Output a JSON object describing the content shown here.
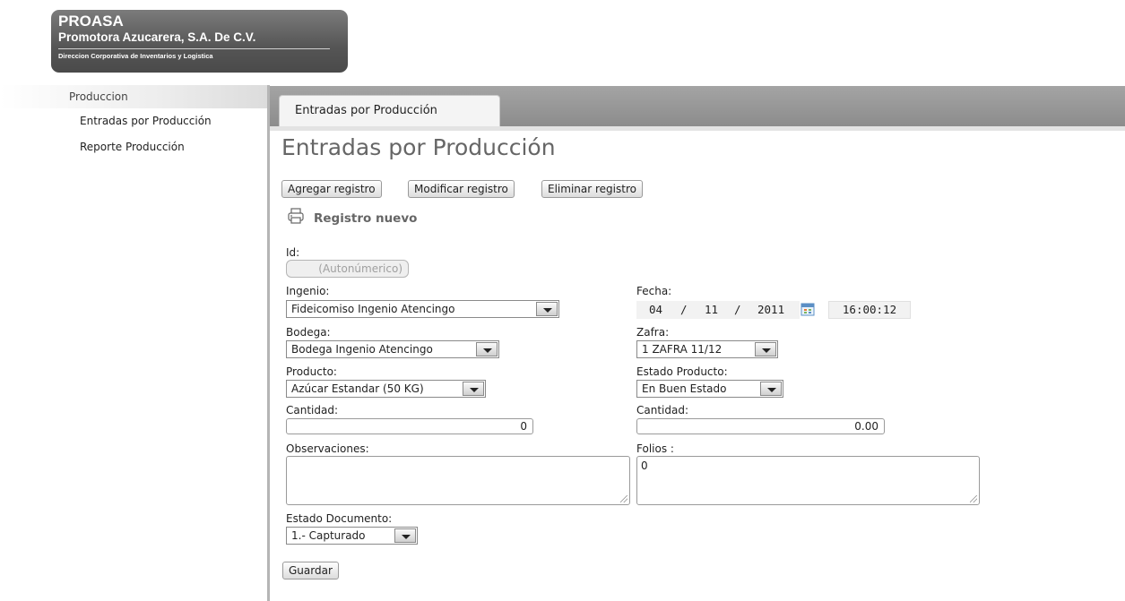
{
  "logo": {
    "line1": "PROASA",
    "line2": "Promotora Azucarera, S.A. De C.V.",
    "line3": "Direccion Corporativa de Inventarios y Logistica"
  },
  "sidebar": {
    "group": "Produccion",
    "items": [
      {
        "label": "Entradas por Producción"
      },
      {
        "label": "Reporte Producción"
      }
    ]
  },
  "tab": {
    "label": "Entradas por Producción"
  },
  "page": {
    "title": "Entradas por Producción"
  },
  "toolbar": {
    "add_label": "Agregar registro",
    "edit_label": "Modificar registro",
    "delete_label": "Eliminar registro"
  },
  "subhead": "Registro nuevo",
  "form": {
    "id_label": "Id:",
    "id_value": "(Autonúmerico)",
    "ingenio_label": "Ingenio:",
    "ingenio_value": "Fideicomiso Ingenio Atencingo",
    "fecha_label": "Fecha:",
    "fecha_day": "04",
    "fecha_month": "11",
    "fecha_year": "2011",
    "fecha_sep": "/",
    "fecha_time": "16:00:12",
    "bodega_label": "Bodega:",
    "bodega_value": "Bodega Ingenio Atencingo",
    "zafra_label": "Zafra:",
    "zafra_value": "1 ZAFRA 11/12",
    "producto_label": "Producto:",
    "producto_value": "Azúcar Estandar (50 KG)",
    "estado_producto_label": "Estado Producto:",
    "estado_producto_value": "En Buen Estado",
    "cantidad_label": "Cantidad:",
    "cantidad_value": "0",
    "cantidad2_label": "Cantidad:",
    "cantidad2_value": "0.00",
    "observaciones_label": "Observaciones:",
    "observaciones_value": "",
    "folios_label": "Folios :",
    "folios_value": "0",
    "estado_documento_label": "Estado Documento:",
    "estado_documento_value": "1.- Capturado",
    "save_label": "Guardar"
  },
  "colors": {
    "tabbar": "#9a9a9a",
    "title": "#666666",
    "sidebar_separator": "#b5b5b5"
  }
}
